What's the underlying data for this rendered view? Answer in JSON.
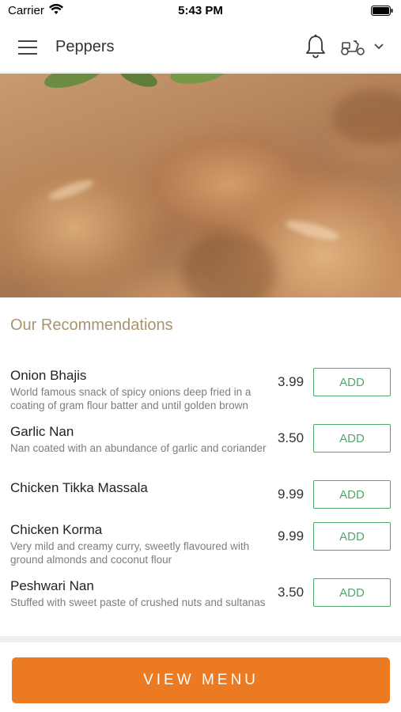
{
  "status_bar": {
    "carrier": "Carrier",
    "time": "5:43 PM"
  },
  "nav": {
    "title": "Peppers",
    "icons": [
      "menu-icon",
      "bell-icon",
      "scooter-icon",
      "chevron-down-icon"
    ]
  },
  "hero": {
    "image": "fried chicken with herbs"
  },
  "recommendations": {
    "title": "Our Recommendations",
    "items": [
      {
        "name": "Onion Bhajis",
        "description": "World famous snack of spicy onions deep fried in a coating of gram flour batter and until golden brown",
        "price": "3.99",
        "button": "ADD"
      },
      {
        "name": "Garlic Nan",
        "description": "Nan coated with an abundance of garlic and coriander",
        "price": "3.50",
        "button": "ADD"
      },
      {
        "name": "Chicken Tikka Massala",
        "description": "",
        "price": "9.99",
        "button": "ADD"
      },
      {
        "name": "Chicken Korma",
        "description": "Very mild and creamy curry, sweetly flavoured with ground almonds and coconut flour",
        "price": "9.99",
        "button": "ADD"
      },
      {
        "name": "Peshwari Nan",
        "description": "Stuffed with sweet paste of crushed nuts and sultanas",
        "price": "3.50",
        "button": "ADD"
      }
    ]
  },
  "footer": {
    "view_menu_label": "VIEW MENU"
  },
  "colors": {
    "accent_orange": "#ec7a22",
    "add_green": "#4fa86a",
    "section_title": "#a8936e"
  }
}
